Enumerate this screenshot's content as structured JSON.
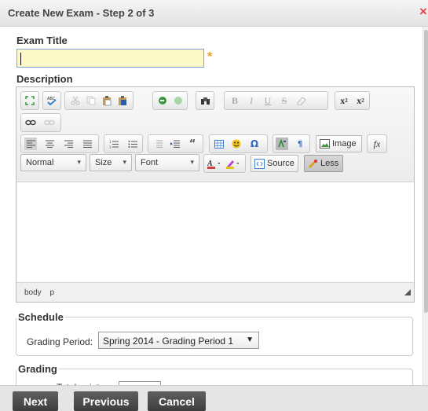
{
  "dialog": {
    "title": "Create New Exam - Step 2 of 3",
    "close_glyph": "×"
  },
  "exam_title": {
    "label": "Exam Title",
    "value": "",
    "required_marker": "*"
  },
  "description": {
    "label": "Description",
    "toolbar": {
      "paragraph_format": "Normal",
      "size": "Size",
      "font": "Font",
      "source_label": "Source",
      "less_label": "Less",
      "image_label": "Image",
      "quote_glyph": "“",
      "omega_glyph": "Ω",
      "fx_glyph": "fx"
    },
    "status_path": [
      "body",
      "p"
    ]
  },
  "schedule": {
    "legend": "Schedule",
    "grading_period_label": "Grading Period:",
    "grading_period_value": "Spring 2014 - Grading Period 1"
  },
  "grading": {
    "legend": "Grading",
    "total_points_label": "Total points:"
  },
  "footer": {
    "next_label": "Next",
    "previous_label": "Previous",
    "cancel_label": "Cancel"
  },
  "colors": {
    "required": "#f29c1f",
    "input_bg": "#fdf9c8",
    "button_bg": "#4a4a4a",
    "close": "#e04848"
  }
}
